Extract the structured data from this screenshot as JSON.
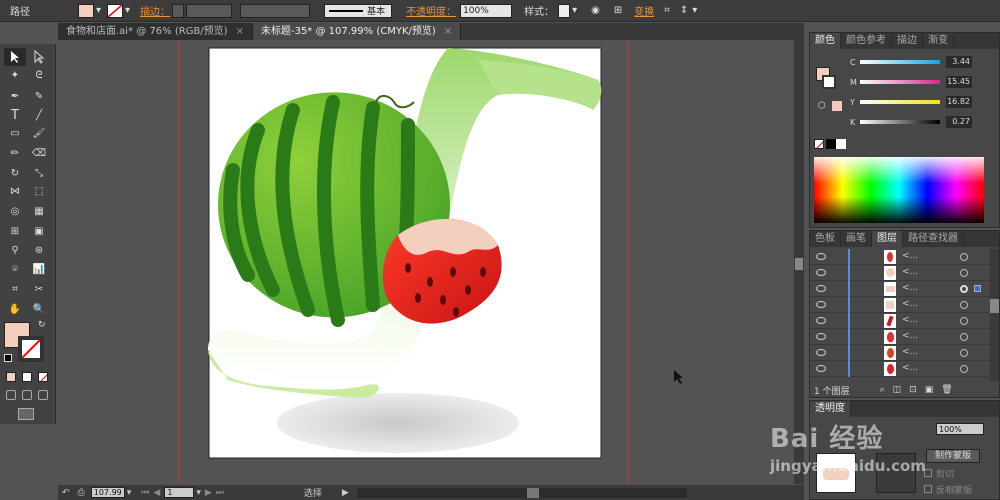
{
  "control_bar": {
    "object_type": "路径",
    "stroke_label": "描边：",
    "brush_label": "基本",
    "opacity_label": "不透明度：",
    "opacity_value": "100%",
    "style_label": "样式：",
    "transform_label": "变换",
    "fill_color": "#f3cfbd"
  },
  "doc_tabs": [
    {
      "label": "食物和店面.ai* @ 76% (RGB/预览)",
      "close": "×"
    },
    {
      "label": "未标题-35* @ 107.99% (CMYK/预览)",
      "close": "×"
    }
  ],
  "status_bar": {
    "zoom": "107.99",
    "page": "1",
    "tool_name": "选择"
  },
  "color_panel": {
    "tabs": [
      "颜色",
      "颜色参考",
      "描边",
      "渐变"
    ],
    "sliders": [
      {
        "label": "C",
        "value": "3.44",
        "gradient_end": "#16a4d8"
      },
      {
        "label": "M",
        "value": "15.45",
        "gradient_end": "#d6278b"
      },
      {
        "label": "Y",
        "value": "16.82",
        "gradient_end": "#ece020"
      },
      {
        "label": "K",
        "value": "0.27",
        "gradient_end": "#000000"
      }
    ]
  },
  "layers_panel": {
    "tabs": [
      "色板",
      "画笔",
      "图层",
      "路径查找器"
    ],
    "rows": [
      {
        "name": "<...",
        "thumb_color": "#e03030"
      },
      {
        "name": "<...",
        "thumb_color": "#f3cfbd"
      },
      {
        "name": "<...",
        "thumb_color": "#f3cfbd"
      },
      {
        "name": "<...",
        "thumb_color": "#f0d0c0"
      },
      {
        "name": "<...",
        "thumb_color": "#c02020"
      },
      {
        "name": "<...",
        "thumb_color": "#e03030"
      },
      {
        "name": "<...",
        "thumb_color": "#e04020"
      },
      {
        "name": "<...",
        "thumb_color": "#e02020"
      }
    ],
    "layer_count": "1 个图层"
  },
  "transparency_panel": {
    "title": "透明度",
    "opacity_value": "100%",
    "make_mask_button": "制作蒙版",
    "clip_label": "剪切",
    "invert_mask_label": "反相蒙版"
  },
  "watermark": {
    "line1": "Bai 经验",
    "line2": "jingyan.baidu.com"
  }
}
